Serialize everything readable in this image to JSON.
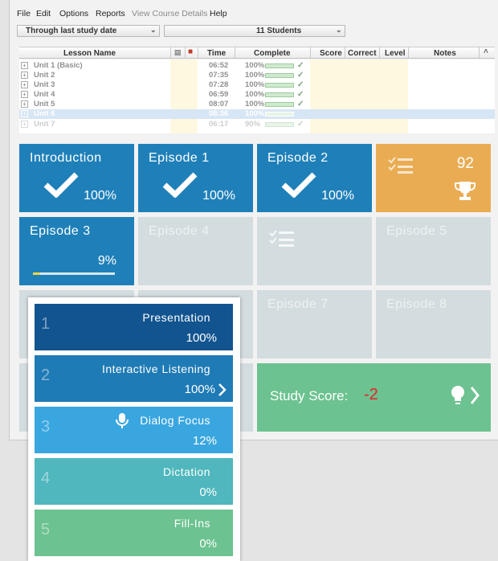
{
  "menu": [
    "File",
    "Edit",
    "Options",
    "Reports",
    "View Course Details",
    "Help"
  ],
  "filters": {
    "date_range": "Through last study date",
    "students": "11 Students"
  },
  "grid": {
    "headers": [
      "Lesson Name",
      "Time",
      "Complete",
      "Score",
      "Correct",
      "Level",
      "Notes"
    ],
    "rows": [
      {
        "name": "Unit 1 (Basic)",
        "time": "06:52",
        "complete": "100%"
      },
      {
        "name": "Unit 2",
        "time": "07:35",
        "complete": "100%"
      },
      {
        "name": "Unit 3",
        "time": "07:28",
        "complete": "100%"
      },
      {
        "name": "Unit 4",
        "time": "06:59",
        "complete": "100%"
      },
      {
        "name": "Unit 5",
        "time": "08:07",
        "complete": "100%"
      },
      {
        "name": "Unit 6",
        "time": "08:36",
        "complete": "100%"
      },
      {
        "name": "Unit 7",
        "time": "06:17",
        "complete": "90%"
      }
    ]
  },
  "tiles": {
    "introduction": {
      "title": "Introduction",
      "pct": "100%"
    },
    "episode1": {
      "title": "Episode 1",
      "pct": "100%"
    },
    "episode2": {
      "title": "Episode 2",
      "pct": "100%"
    },
    "quiz_score": "92",
    "episode3": {
      "title": "Episode 3",
      "pct": "9%",
      "progress": 0.09
    },
    "episode4": {
      "title": "Episode 4"
    },
    "episode5": {
      "title": "Episode 5"
    },
    "episode7": {
      "title": "Episode 7"
    },
    "episode8": {
      "title": "Episode 8"
    },
    "study_score": {
      "label": "Study Score:",
      "value": "-2"
    }
  },
  "steps": [
    {
      "num": "1",
      "name": "Presentation",
      "pct": "100%"
    },
    {
      "num": "2",
      "name": "Interactive Listening",
      "pct": "100%"
    },
    {
      "num": "3",
      "name": "Dialog Focus",
      "pct": "12%"
    },
    {
      "num": "4",
      "name": "Dictation",
      "pct": "0%"
    },
    {
      "num": "5",
      "name": "Fill-Ins",
      "pct": "0%"
    }
  ],
  "colors": {
    "tile_blue": "#1f80b9",
    "tile_grey": "#d3dcdf",
    "tile_orange": "#e9ac53",
    "tile_green": "#6cc290",
    "study_score_value": "#e8202a"
  }
}
